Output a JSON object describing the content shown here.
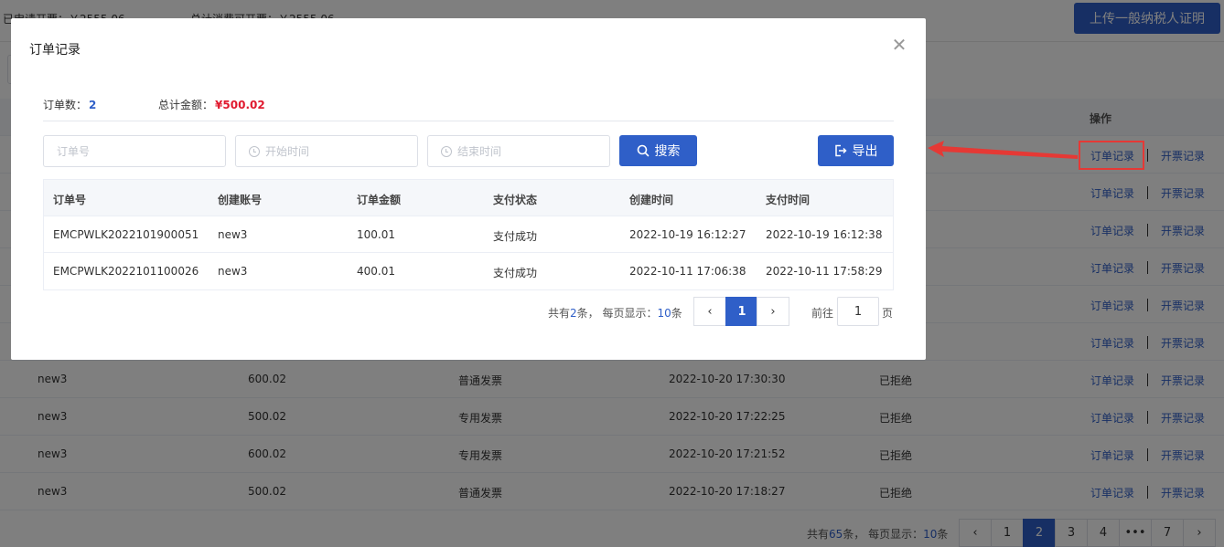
{
  "background": {
    "stats": [
      {
        "text": "已申请开票：￥2555.06"
      },
      {
        "text": "总计消费可开票：￥2555.06"
      }
    ],
    "upload_button": "上传一般纳税人证明",
    "operation_header": "操作",
    "order_link": "订单记录",
    "invoice_link": "开票记录",
    "rows": [
      {
        "account": "new3",
        "amount": "600.02",
        "type": "普通发票",
        "time": "2022-10-20 17:30:30",
        "status": "已拒绝"
      },
      {
        "account": "new3",
        "amount": "500.02",
        "type": "专用发票",
        "time": "2022-10-20 17:22:25",
        "status": "已拒绝"
      },
      {
        "account": "new3",
        "amount": "600.02",
        "type": "专用发票",
        "time": "2022-10-20 17:21:52",
        "status": "已拒绝"
      },
      {
        "account": "new3",
        "amount": "500.02",
        "type": "普通发票",
        "time": "2022-10-20 17:18:27",
        "status": "已拒绝"
      }
    ],
    "pager": {
      "prefix": "共有",
      "total": "65",
      "mid": "条， 每页显示：",
      "per_page": "10",
      "suffix": "条",
      "pages": [
        "1",
        "2",
        "3",
        "4",
        "•••",
        "7"
      ],
      "active_page": "2"
    }
  },
  "dialog": {
    "title": "订单记录",
    "summary": {
      "count_label": "订单数：",
      "count": "2",
      "amount_label": "总计金额：",
      "amount": "¥500.02"
    },
    "filters": {
      "order_no_placeholder": "订单号",
      "start_placeholder": "开始时间",
      "end_placeholder": "结束时间"
    },
    "search_button": "搜索",
    "export_button": "导出",
    "columns": [
      "订单号",
      "创建账号",
      "订单金额",
      "支付状态",
      "创建时间",
      "支付时间"
    ],
    "rows": [
      [
        "EMCPWLK2022101900051",
        "new3",
        "100.01",
        "支付成功",
        "2022-10-19 16:12:27",
        "2022-10-19 16:12:38"
      ],
      [
        "EMCPWLK2022101100026",
        "new3",
        "400.01",
        "支付成功",
        "2022-10-11 17:06:38",
        "2022-10-11 17:58:29"
      ]
    ],
    "pager": {
      "prefix": "共有",
      "total": "2",
      "mid": "条， 每页显示：",
      "per_page": "10",
      "suffix": "条",
      "page": "1",
      "goto_label": "前往",
      "goto_value": "1",
      "goto_unit": "页"
    }
  },
  "colors": {
    "primary": "#2f5fc8",
    "amount": "#e0192e",
    "highlight": "#e53935"
  }
}
